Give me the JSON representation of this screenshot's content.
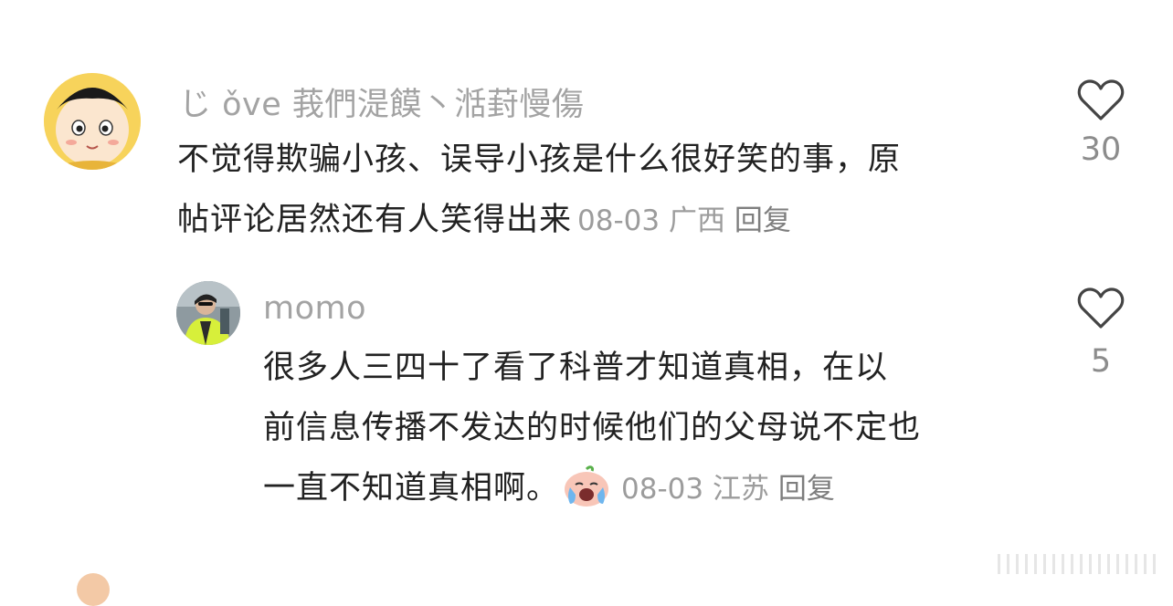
{
  "comments": [
    {
      "username": "じ ǒve 莪們湜饃丶湉葑慢傷",
      "lines": [
        "不觉得欺骗小孩、误导小孩是什么很好笑的事，原",
        "帖评论居然还有人笑得出来"
      ],
      "date": "08-03",
      "location": "广西",
      "reply_label": "回复",
      "likes": "30"
    }
  ],
  "reply": {
    "username": "momo",
    "lines": [
      "很多人三四十了看了科普才知道真相，在以",
      "前信息传播不发达的时候他们的父母说不定也",
      "一直不知道真相啊。"
    ],
    "emoji": "crying-face-emoji",
    "date": "08-03",
    "location": "江苏",
    "reply_label": "回复",
    "likes": "5"
  },
  "icons": {
    "like": "heart-outline-icon"
  },
  "colors": {
    "secondary_text": "#a3a3a3",
    "body_text": "#222222",
    "heart": "#444444"
  }
}
